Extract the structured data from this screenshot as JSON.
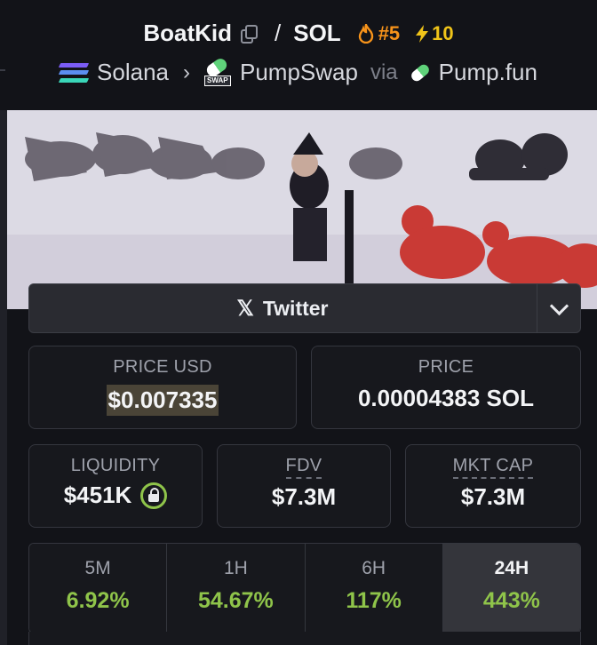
{
  "header": {
    "token_name": "BoatKid",
    "separator": "/",
    "quote": "SOL",
    "rank": "#5",
    "boosts": "10",
    "chain": "Solana",
    "dex": "PumpSwap",
    "via": "via",
    "launchpad": "Pump.fun"
  },
  "icons": {
    "copy": "copy-icon",
    "fire": "fire-icon",
    "bolt": "lightning-icon",
    "solana": "solana-icon",
    "swap": "pumpswap-icon",
    "pill": "pumpfun-icon",
    "x": "x-icon",
    "chevron": "chevron-down-icon",
    "lock": "lock-icon"
  },
  "colors": {
    "accent_orange": "#f7931a",
    "accent_yellow": "#f0c419",
    "positive_green": "#8fc44a"
  },
  "social": {
    "twitter_label": "Twitter"
  },
  "stats": {
    "price_usd_label": "PRICE USD",
    "price_usd": "$0.007335",
    "price_label": "PRICE",
    "price_native": "0.00004383 SOL",
    "liquidity_label": "LIQUIDITY",
    "liquidity": "$451K",
    "fdv_label": "FDV",
    "fdv": "$7.3M",
    "mcap_label": "MKT CAP",
    "mcap": "$7.3M"
  },
  "changes": [
    {
      "label": "5M",
      "value": "6.92%"
    },
    {
      "label": "1H",
      "value": "54.67%"
    },
    {
      "label": "6H",
      "value": "117%"
    },
    {
      "label": "24H",
      "value": "443%",
      "active": true
    }
  ]
}
